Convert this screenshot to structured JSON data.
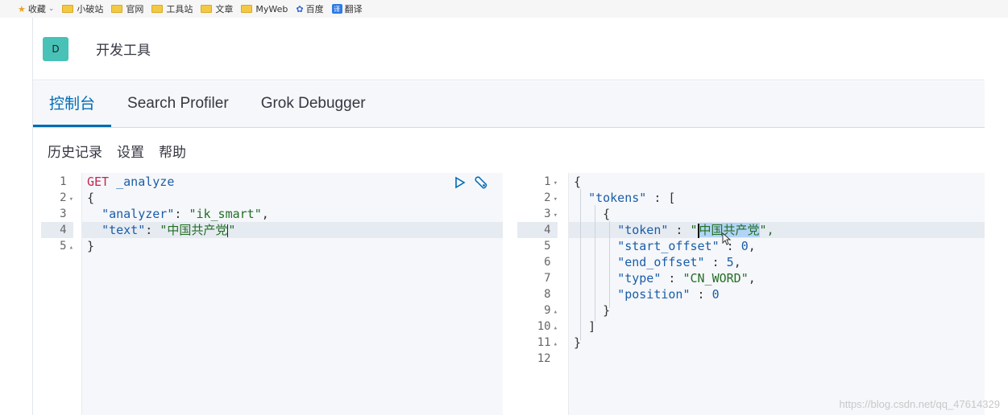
{
  "bookmarks": [
    {
      "label": "收藏",
      "icon": "star-icon"
    },
    {
      "label": "小破站",
      "icon": "folder-icon"
    },
    {
      "label": "官网",
      "icon": "folder-icon"
    },
    {
      "label": "工具站",
      "icon": "folder-icon"
    },
    {
      "label": "文章",
      "icon": "folder-icon"
    },
    {
      "label": "MyWeb",
      "icon": "folder-icon"
    },
    {
      "label": "百度",
      "icon": "baidu-icon"
    },
    {
      "label": "翻译",
      "icon": "translate-icon"
    }
  ],
  "app": {
    "icon_letter": "D",
    "title": "开发工具"
  },
  "tabs": [
    {
      "label": "控制台",
      "active": true
    },
    {
      "label": "Search Profiler",
      "active": false
    },
    {
      "label": "Grok Debugger",
      "active": false
    }
  ],
  "toolbar": {
    "history": "历史记录",
    "settings": "设置",
    "help": "帮助"
  },
  "request": {
    "line_numbers": [
      "1",
      "2",
      "3",
      "4",
      "5"
    ],
    "method": "GET",
    "path": " _analyze",
    "open_brace": "{",
    "analyzer_key": "\"analyzer\"",
    "analyzer_value": "\"ik_smart\"",
    "text_key": "\"text\"",
    "text_value": "\"中国共产党",
    "text_value_end": "\"",
    "close_brace": "}"
  },
  "response": {
    "line_numbers": [
      "1",
      "2",
      "3",
      "4",
      "5",
      "6",
      "7",
      "8",
      "9",
      "10",
      "11",
      "12"
    ],
    "l1": "{",
    "tokens_key": "\"tokens\"",
    "l2_rest": " : [",
    "l3": "{",
    "token_key": "\"token\"",
    "token_value_open": "\"",
    "token_value": "中国共产党",
    "token_value_close": "\",",
    "start_offset_key": "\"start_offset\"",
    "start_offset_value": "0",
    "end_offset_key": "\"end_offset\"",
    "end_offset_value": "5",
    "type_key": "\"type\"",
    "type_value": "\"CN_WORD\"",
    "position_key": "\"position\"",
    "position_value": "0",
    "l9": "}",
    "l10": "]",
    "l11": "}"
  },
  "watermark": "https://blog.csdn.net/qq_47614329",
  "colors": {
    "accent": "#006bb4",
    "app_icon": "#48c1b7",
    "method": "#c7254e",
    "string": "#236e25",
    "key": "#1a5da8"
  }
}
